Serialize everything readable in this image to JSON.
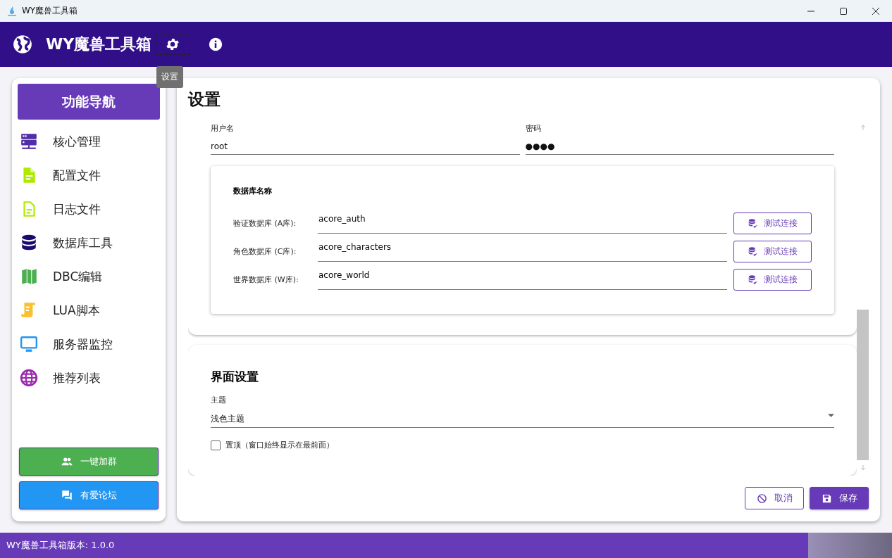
{
  "window": {
    "title": "WY魔兽工具箱"
  },
  "app_bar": {
    "title": "WY魔兽工具箱",
    "tooltip": "设置"
  },
  "sidebar": {
    "header": "功能导航",
    "items": [
      {
        "label": "核心管理",
        "kind": "server",
        "color": "#512da8"
      },
      {
        "label": "配置文件",
        "kind": "file",
        "color": "#aeea00"
      },
      {
        "label": "日志文件",
        "kind": "outline",
        "color": "#aeea00"
      },
      {
        "label": "数据库工具",
        "kind": "database",
        "color": "#1a0a6b"
      },
      {
        "label": "DBC编辑",
        "kind": "map",
        "color": "#4caf50"
      },
      {
        "label": "LUA脚本",
        "kind": "scroll",
        "color": "#fbc02d"
      },
      {
        "label": "服务器监控",
        "kind": "monitor",
        "color": "#2196f3"
      },
      {
        "label": "推荐列表",
        "kind": "globe",
        "color": "#9c27b0"
      }
    ],
    "buttons": [
      {
        "label": "一键加群",
        "kind": "people",
        "color": "#4caf50"
      },
      {
        "label": "有爱论坛",
        "kind": "forum",
        "color": "#2196f3"
      }
    ]
  },
  "settings": {
    "title": "设置",
    "credentials": [
      {
        "label": "用户名",
        "value": "root"
      },
      {
        "label": "密码",
        "value": "●●●●"
      }
    ],
    "databases": {
      "title": "数据库名称",
      "rows": [
        {
          "label": "验证数据库 (A库):",
          "value": "acore_auth",
          "button": "测试连接"
        },
        {
          "label": "角色数据库 (C库):",
          "value": "acore_characters",
          "button": "测试连接"
        },
        {
          "label": "世界数据库 (W库):",
          "value": "acore_world",
          "button": "测试连接"
        }
      ]
    },
    "interface": {
      "title": "界面设置",
      "theme_label": "主题",
      "theme_value": "浅色主题",
      "topmost": {
        "label": "置顶（窗口始终显示在最前面）",
        "checked": false
      }
    },
    "cancel": "取消",
    "save": "保存"
  },
  "status_bar": {
    "text": "WY魔兽工具箱版本: 1.0.0"
  }
}
